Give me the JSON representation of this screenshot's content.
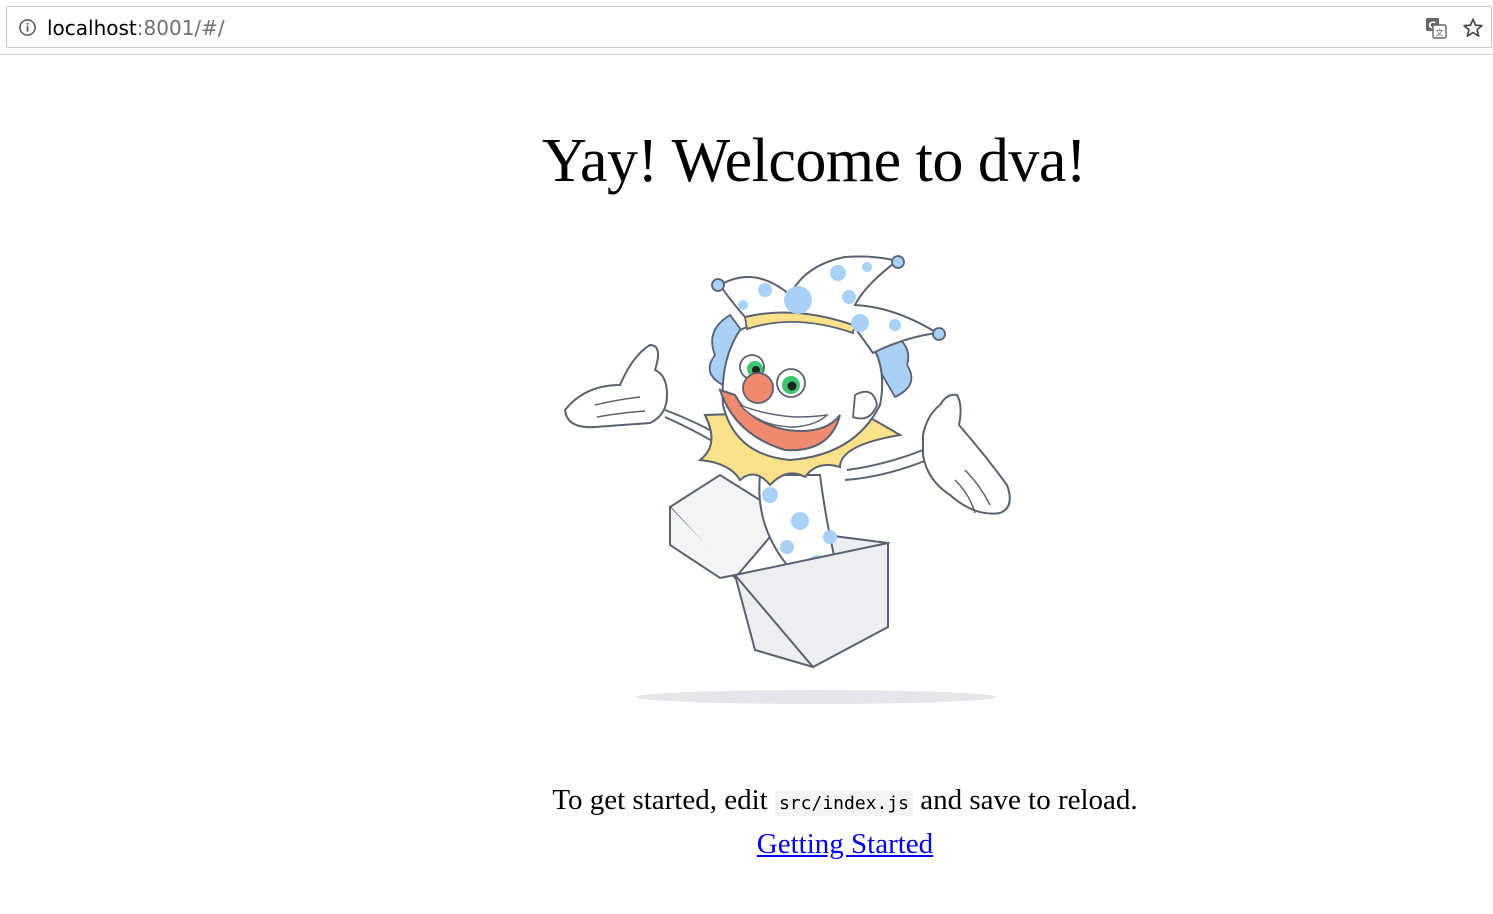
{
  "browser": {
    "url_host": "localhost",
    "url_rest": ":8001/#/",
    "icons": [
      "info-icon",
      "translate-icon",
      "bookmark-star-icon"
    ]
  },
  "page": {
    "title": "Yay! Welcome to dva!",
    "intro_before": "To get started, edit ",
    "intro_code": "src/index.js",
    "intro_after": " and save to reload.",
    "link_label": "Getting Started"
  },
  "colors": {
    "link": "#0000ee",
    "clown_blue": "#a9d1f5",
    "clown_nose": "#f08a6e",
    "clown_collar": "#fbe28a",
    "clown_eye": "#3ec46d",
    "outline": "#5a6170"
  }
}
